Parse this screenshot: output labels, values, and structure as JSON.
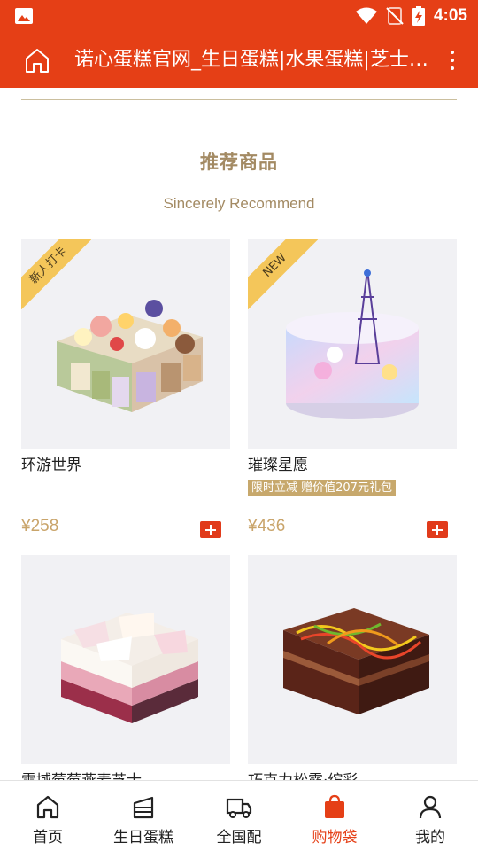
{
  "status_bar": {
    "time": "4:05"
  },
  "toolbar": {
    "title": "诺心蛋糕官网_生日蛋糕|水果蛋糕|芝士蛋糕|慕斯蛋糕"
  },
  "section": {
    "title": "推荐商品",
    "subtitle": "Sincerely Recommend"
  },
  "products": [
    {
      "ribbon": "新人打卡",
      "name": "环游世界",
      "promo": "",
      "price": "¥258"
    },
    {
      "ribbon": "NEW",
      "name": "璀璨星愿",
      "promo": "限时立减 赠价值207元礼包",
      "price": "¥436"
    },
    {
      "ribbon": "",
      "name": "雪域莓莓燕麦芝士",
      "promo": "",
      "price": ""
    },
    {
      "ribbon": "",
      "name": "巧克力松露·缤彩",
      "promo": "",
      "price": ""
    }
  ],
  "tabbar": {
    "items": [
      {
        "label": "首页",
        "icon": "home-icon"
      },
      {
        "label": "生日蛋糕",
        "icon": "cake-icon"
      },
      {
        "label": "全国配",
        "icon": "truck-icon"
      },
      {
        "label": "购物袋",
        "icon": "shopping-bag-icon",
        "active": true
      },
      {
        "label": "我的",
        "icon": "user-icon"
      }
    ]
  },
  "colors": {
    "brand": "#e53f16",
    "gold": "#a38a63",
    "price": "#c9a46a",
    "ribbon": "#f4c65a"
  }
}
